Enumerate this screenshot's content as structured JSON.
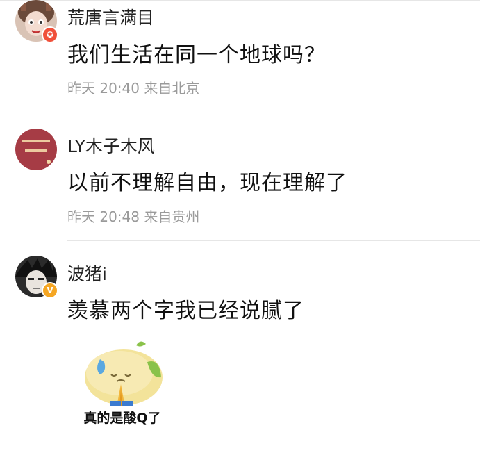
{
  "comments": [
    {
      "username": "荒唐言满目",
      "text": "我们生活在同一个地球吗？",
      "meta": "昨天 20:40 来自北京",
      "badge": "✪",
      "badge_color": "#f0503a",
      "avatar_icon": "cartoon-girl-avatar"
    },
    {
      "username": "LY木子木风",
      "text": "以前不理解自由，现在理解了",
      "meta": "昨天 20:48 来自贵州",
      "avatar_icon": "red-text-avatar",
      "avatar_color": "#a63c45"
    },
    {
      "username": "波猪i",
      "text": "羡慕两个字我已经说腻了",
      "badge": "V",
      "badge_color": "#f5a623",
      "avatar_icon": "anime-character-avatar",
      "sticker": {
        "caption": "真的是酸Q了",
        "icon": "sour-lemon-praying-sticker"
      }
    }
  ]
}
